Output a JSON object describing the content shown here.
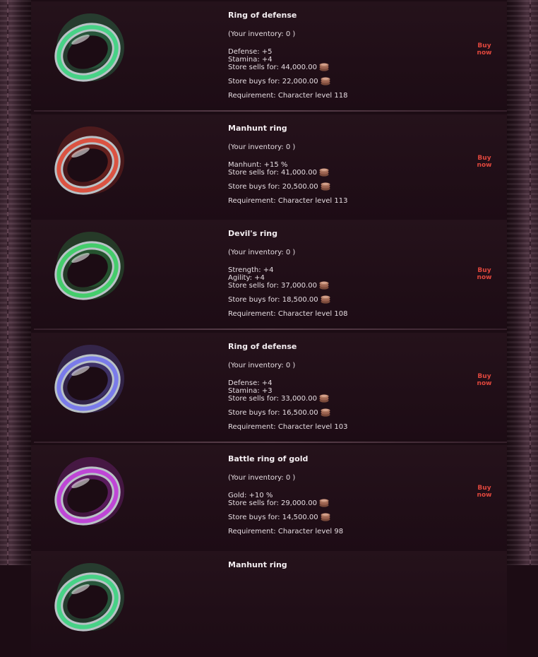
{
  "items": [
    {
      "name": "Ring of defense",
      "inventory": "(Your inventory: 0 )",
      "stats": [
        "Defense: +5",
        "Stamina: +4"
      ],
      "sells": "Store sells for: 44,000.00",
      "buys": "Store buys for: 22,000.00",
      "requirement": "Requirement: Character level 118",
      "buy_label": [
        "Buy",
        "now"
      ],
      "ring_color": "#33d57a",
      "ring_icon": "green-ring-icon"
    },
    {
      "name": "Manhunt ring",
      "inventory": "(Your inventory: 0 )",
      "stats": [
        "Manhunt: +15 %"
      ],
      "sells": "Store sells for: 41,000.00",
      "buys": "Store buys for: 20,500.00",
      "requirement": "Requirement: Character level 113",
      "buy_label": [
        "Buy",
        "now"
      ],
      "ring_color": "#e0402a",
      "ring_icon": "red-ring-icon"
    },
    {
      "name": "Devil's ring",
      "inventory": "(Your inventory: 0 )",
      "stats": [
        "Strength: +4",
        "Agility: +4"
      ],
      "sells": "Store sells for: 37,000.00",
      "buys": "Store buys for: 18,500.00",
      "requirement": "Requirement: Character level 108",
      "buy_label": [
        "Buy",
        "now"
      ],
      "ring_color": "#2fcf5a",
      "ring_icon": "skull-ring-icon"
    },
    {
      "name": "Ring of defense",
      "inventory": "(Your inventory: 0 )",
      "stats": [
        "Defense: +4",
        "Stamina: +3"
      ],
      "sells": "Store sells for: 33,000.00",
      "buys": "Store buys for: 16,500.00",
      "requirement": "Requirement: Character level 103",
      "buy_label": [
        "Buy",
        "now"
      ],
      "ring_color": "#6f6ff0",
      "ring_icon": "blue-ring-icon"
    },
    {
      "name": "Battle ring of gold",
      "inventory": "(Your inventory: 0 )",
      "stats": [
        "Gold: +10 %"
      ],
      "sells": "Store sells for: 29,000.00",
      "buys": "Store buys for: 14,500.00",
      "requirement": "Requirement: Character level 98",
      "buy_label": [
        "Buy",
        "now"
      ],
      "ring_color": "#c030d8",
      "ring_icon": "purple-ring-icon"
    },
    {
      "name": "Manhunt ring",
      "ring_color": "#33d57a",
      "ring_icon": "green-ring-icon"
    }
  ],
  "colors": {
    "background": "#1c0c14",
    "text": "#e6dde2",
    "buy_link": "#e0473d",
    "coin": "#b07a63"
  }
}
